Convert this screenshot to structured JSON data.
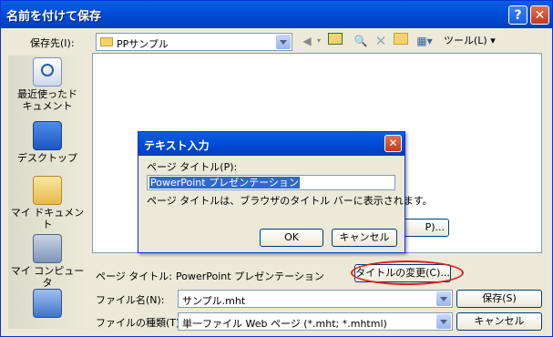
{
  "window": {
    "title": "名前を付けて保存",
    "help_glyph": "?",
    "close_glyph": "✕"
  },
  "toolbar": {
    "save_in_label": "保存先(I):",
    "save_in_value": "PPサンプル",
    "tools_label": "ツール(L) ▾"
  },
  "places": [
    {
      "label": "最近使ったド\nキュメント",
      "icon": "recent-documents-icon"
    },
    {
      "label": "デスクトップ",
      "icon": "desktop-icon"
    },
    {
      "label": "マイ ドキュメント",
      "icon": "my-documents-icon"
    },
    {
      "label": "マイ コンピュータ",
      "icon": "my-computer-icon"
    },
    {
      "label": "",
      "icon": "network-icon"
    }
  ],
  "page_title_row": {
    "label": "ページ タイトル:",
    "value": "PowerPoint プレゼンテーション",
    "change_button": "タイトルの変更(C)..."
  },
  "partial_button": "P)...",
  "filename": {
    "label": "ファイル名(N):",
    "value": "サンプル.mht",
    "save_button": "保存(S)"
  },
  "filetype": {
    "label": "ファイルの種類(T):",
    "value": "単一ファイル Web ページ (*.mht; *.mhtml)",
    "cancel_button": "キャンセル"
  },
  "dialog": {
    "title": "テキスト入力",
    "field_label": "ページ タイトル(P):",
    "field_value": "PowerPoint プレゼンテーション",
    "hint": "ページ タイトルは、ブラウザのタイトル バーに表示されます。",
    "ok_button": "OK",
    "cancel_button": "キャンセル",
    "close_glyph": "✕"
  },
  "colors": {
    "titlebar": "#0050d8",
    "dialog_bg": "#ece9d8",
    "highlight": "#316ac5",
    "annotation": "#e0201c"
  }
}
